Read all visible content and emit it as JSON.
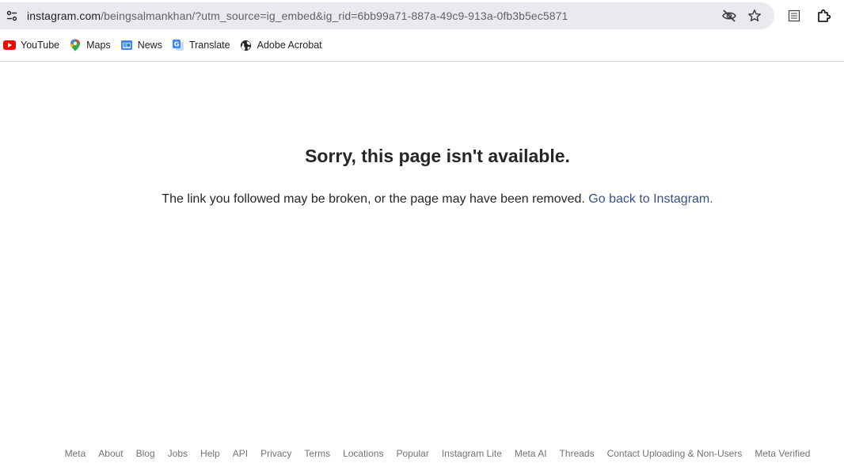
{
  "browser": {
    "url_host": "instagram.com",
    "url_path": "/beingsalmankhan/?utm_source=ig_embed&ig_rid=6bb99a71-887a-49c9-913a-0fb3b5ec5871",
    "icons": {
      "site_info": "tune-icon",
      "eye_off": "eye-off-icon",
      "bookmark_star": "star-icon",
      "reading_list": "reading-mode-icon",
      "extensions": "puzzle-icon"
    }
  },
  "bookmarks": [
    {
      "label": "YouTube",
      "icon": "youtube-icon",
      "color": "#ff0000"
    },
    {
      "label": "Maps",
      "icon": "maps-icon",
      "color": "#34a853"
    },
    {
      "label": "News",
      "icon": "news-icon",
      "color": "#4285f4"
    },
    {
      "label": "Translate",
      "icon": "translate-icon",
      "color": "#4285f4"
    },
    {
      "label": "Adobe Acrobat",
      "icon": "globe-icon",
      "color": "#202124"
    }
  ],
  "error": {
    "title": "Sorry, this page isn't available.",
    "body": "The link you followed may be broken, or the page may have been removed.",
    "link": "Go back to Instagram."
  },
  "footer": {
    "links": [
      "Meta",
      "About",
      "Blog",
      "Jobs",
      "Help",
      "API",
      "Privacy",
      "Terms",
      "Locations",
      "Popular",
      "Instagram Lite",
      "Meta AI",
      "Threads",
      "Contact Uploading & Non-Users",
      "Meta Verified"
    ]
  },
  "colors": {
    "link": "#385185",
    "text": "#262626",
    "footer_text": "#737373",
    "omnibox": "#e8eaed"
  }
}
